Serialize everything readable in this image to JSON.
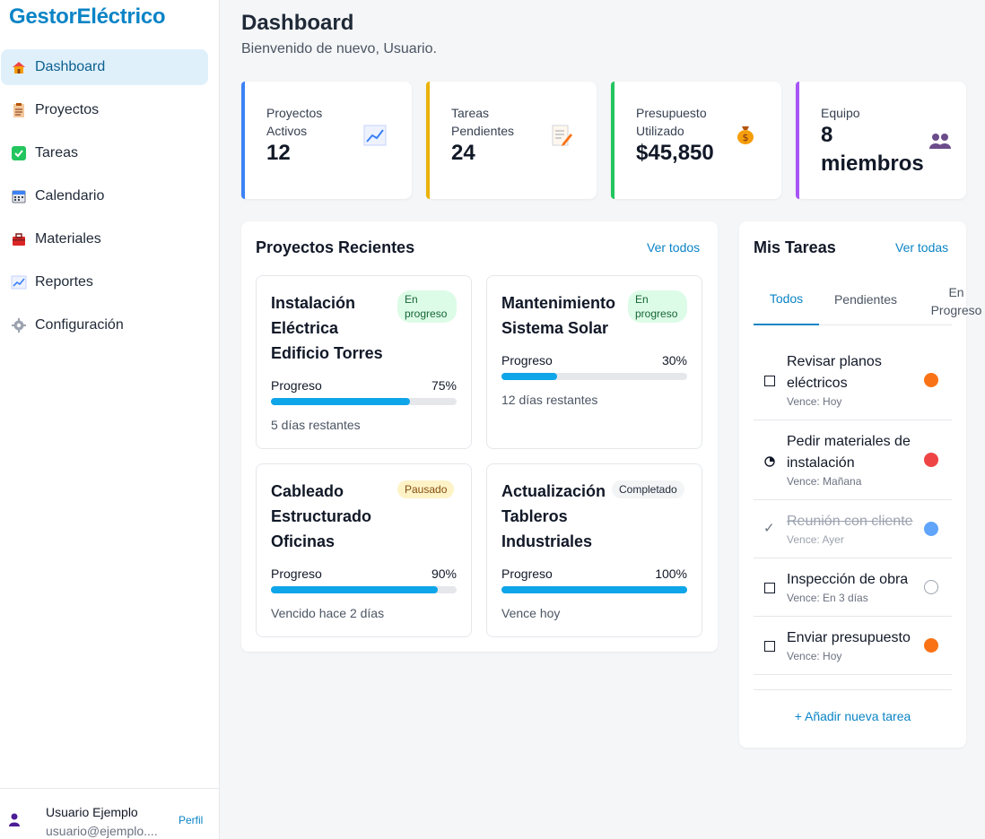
{
  "app": {
    "brand": "GestorEléctrico"
  },
  "sidebar": {
    "items": [
      {
        "label": "Dashboard",
        "icon": "house-icon"
      },
      {
        "label": "Proyectos",
        "icon": "clipboard-icon"
      },
      {
        "label": "Tareas",
        "icon": "check-box-icon"
      },
      {
        "label": "Calendario",
        "icon": "calendar-icon"
      },
      {
        "label": "Materiales",
        "icon": "toolbox-icon"
      },
      {
        "label": "Reportes",
        "icon": "chart-icon"
      },
      {
        "label": "Configuración",
        "icon": "gear-icon"
      }
    ],
    "user": {
      "name": "Usuario Ejemplo",
      "email": "usuario@ejemplo....",
      "profile_link": "Perfil"
    }
  },
  "header": {
    "title": "Dashboard",
    "subtitle": "Bienvenido de nuevo, Usuario."
  },
  "stats": [
    {
      "label": "Proyectos Activos",
      "value": "12",
      "icon": "chart-icon",
      "color": "#3b82f6"
    },
    {
      "label": "Tareas Pendientes",
      "value": "24",
      "icon": "memo-icon",
      "color": "#eab308"
    },
    {
      "label": "Presupuesto Utilizado",
      "value": "$45,850",
      "icon": "money-bag-icon",
      "color": "#22c55e"
    },
    {
      "label": "Equipo",
      "value": "8 miembros",
      "icon": "people-icon",
      "color": "#a855f7"
    }
  ],
  "projects": {
    "title": "Proyectos Recientes",
    "view_all": "Ver todos",
    "progress_label": "Progreso",
    "items": [
      {
        "name": "Instalación Eléctrica Edificio Torres",
        "status": "En progreso",
        "progress": "75%",
        "progress_value": 0.75,
        "note": "5 días restantes"
      },
      {
        "name": "Mantenimiento Sistema Solar",
        "status": "En progreso",
        "progress": "30%",
        "progress_value": 0.3,
        "note": "12 días restantes"
      },
      {
        "name": "Cableado Estructurado Oficinas",
        "status": "Pausado",
        "progress": "90%",
        "progress_value": 0.9,
        "note": "Vencido hace 2 días"
      },
      {
        "name": "Actualización Tableros Industriales",
        "status": "Completado",
        "progress": "100%",
        "progress_value": 1.0,
        "note": "Vence hoy"
      }
    ]
  },
  "tasks": {
    "title": "Mis Tareas",
    "view_all": "Ver todas",
    "tabs": [
      "Todos",
      "Pendientes",
      "En Progreso"
    ],
    "items": [
      {
        "title": "Revisar planos eléctricos",
        "due": "Vence: Hoy",
        "priority_color": "#f97316",
        "state": "pending"
      },
      {
        "title": "Pedir materiales de instalación",
        "due": "Vence: Mañana",
        "priority_color": "#ef4444",
        "state": "in-progress"
      },
      {
        "title": "Reunión con cliente",
        "due": "Vence: Ayer",
        "priority_color": "#60a5fa",
        "state": "done"
      },
      {
        "title": "Inspección de obra",
        "due": "Vence: En 3 días",
        "priority_color": "#ffffff",
        "state": "pending"
      },
      {
        "title": "Enviar presupuesto",
        "due": "Vence: Hoy",
        "priority_color": "#f97316",
        "state": "pending"
      }
    ],
    "add_task": "+ Añadir nueva tarea"
  }
}
